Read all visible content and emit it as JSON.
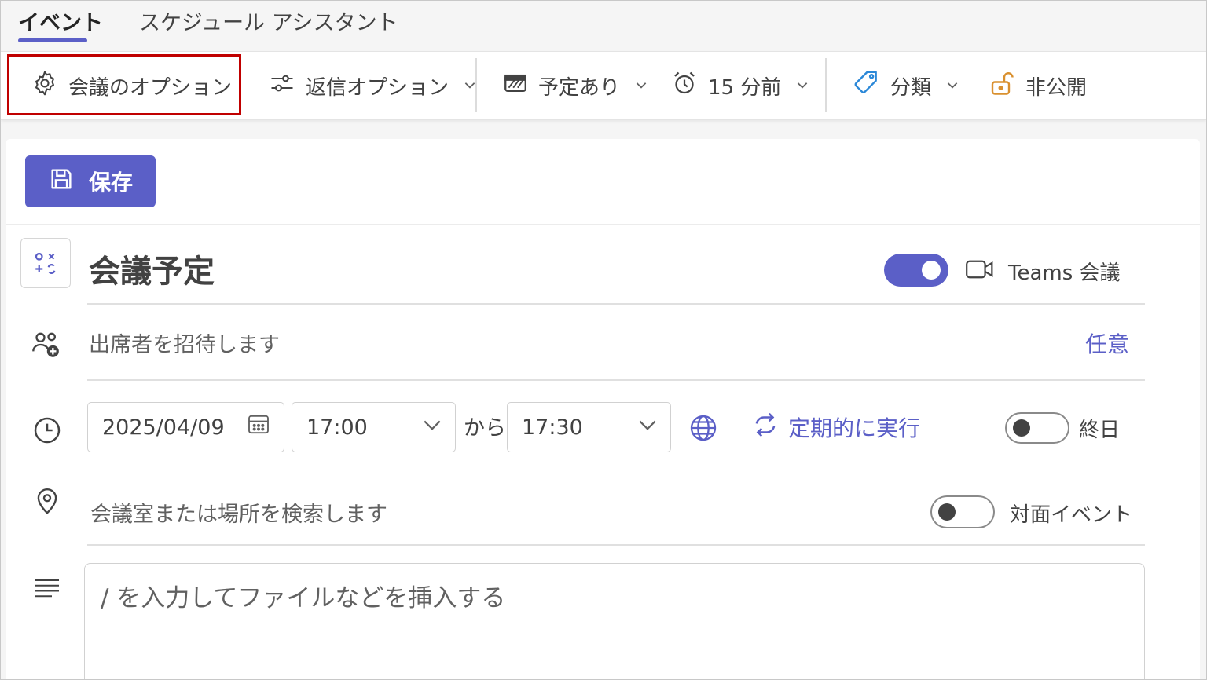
{
  "tabs": [
    {
      "label": "イベント",
      "active": true
    },
    {
      "label": "スケジュール アシスタント",
      "active": false
    }
  ],
  "toolbar": {
    "meeting_options": {
      "label": "会議のオプション",
      "icon": "gear-icon"
    },
    "response_options": {
      "label": "返信オプション",
      "icon": "sliders-icon"
    },
    "show_as": {
      "label": "予定あり",
      "icon": "busy-status-icon"
    },
    "reminder": {
      "label": "15 分前",
      "icon": "alarm-icon"
    },
    "categorize": {
      "label": "分類",
      "icon": "tag-icon"
    },
    "privacy": {
      "label": "非公開",
      "icon": "unlock-icon"
    },
    "highlight_color": "#c00000"
  },
  "save_button": {
    "label": "保存",
    "icon": "save-icon"
  },
  "title": {
    "text": "会議予定",
    "icon": "category-icon"
  },
  "teams_meeting": {
    "label": "Teams 会議",
    "enabled": true,
    "icon": "video-camera-icon"
  },
  "attendees": {
    "placeholder": "出席者を招待します",
    "optional_link": "任意",
    "icon": "people-add-icon"
  },
  "datetime": {
    "date": "2025/04/09",
    "start_time": "17:00",
    "separator": "から",
    "end_time": "17:30",
    "recurrence_label": "定期的に実行",
    "all_day_label": "終日",
    "all_day_enabled": false
  },
  "location": {
    "placeholder": "会議室または場所を検索します",
    "in_person_label": "対面イベント",
    "in_person_enabled": false
  },
  "body": {
    "placeholder": "/ を入力してファイルなどを挿入する"
  },
  "colors": {
    "accent": "#5b5fc7",
    "text": "#424242"
  }
}
